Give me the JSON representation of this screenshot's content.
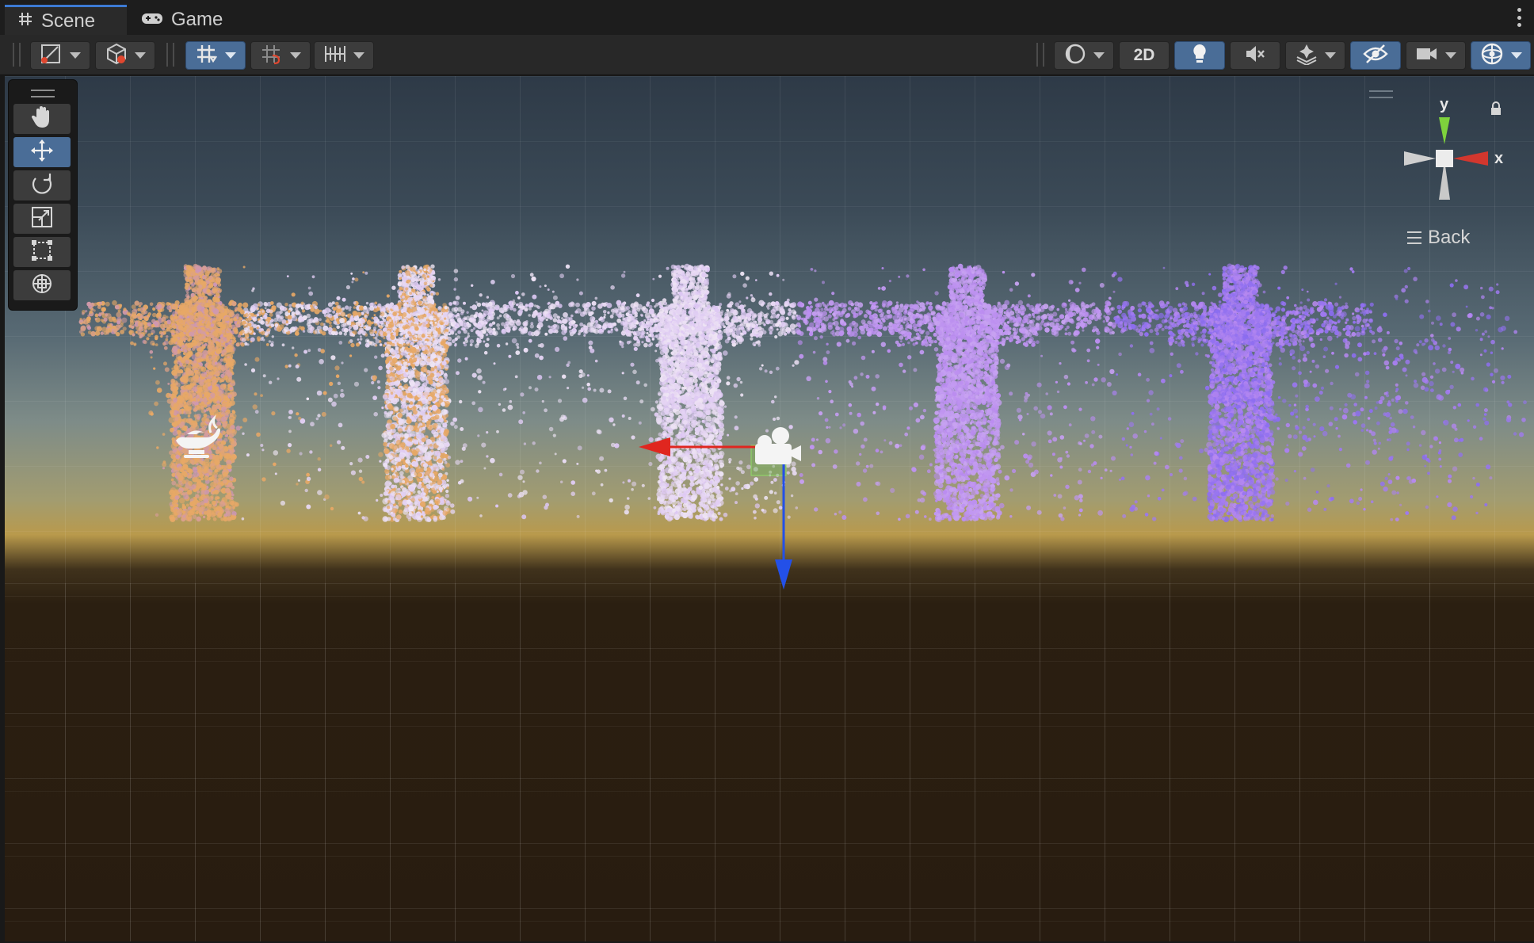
{
  "tabs": [
    {
      "label": "Scene",
      "icon": "hash-icon",
      "active": true
    },
    {
      "label": "Game",
      "icon": "gamepad-icon",
      "active": false
    }
  ],
  "toolbar": {
    "draw_mode_icon": "draw-mode-icon",
    "render_mode_icon": "render-mode-icon",
    "grid_snapping_icon": "grid-snapping-icon",
    "increment_snap_icon": "increment-snap-icon",
    "grid_visibility_icon": "grid-visibility-icon",
    "shading_icon": "shading-icon",
    "toggle_2d_label": "2D",
    "lighting_icon": "lightbulb-icon",
    "audio_icon": "audio-mute-icon",
    "effects_icon": "effects-icon",
    "hidden_objects_icon": "eye-slash-icon",
    "camera_icon": "camera-icon",
    "gizmos_icon": "gizmos-icon",
    "active": {
      "toggle_2d": false,
      "lighting": true,
      "hidden_objects": true,
      "gizmos": true,
      "grid_snapping": true
    }
  },
  "tools": [
    {
      "name": "hand-tool",
      "icon": "hand-icon",
      "active": false
    },
    {
      "name": "move-tool",
      "icon": "move-icon",
      "active": true
    },
    {
      "name": "rotate-tool",
      "icon": "rotate-icon",
      "active": false
    },
    {
      "name": "scale-tool",
      "icon": "scale-icon",
      "active": false
    },
    {
      "name": "rect-tool",
      "icon": "rect-icon",
      "active": false
    },
    {
      "name": "transform-tool",
      "icon": "transform-icon",
      "active": false
    }
  ],
  "orientation_gizmo": {
    "y_label": "y",
    "x_label": "x",
    "view_label": "Back",
    "colors": {
      "x": "#d2372e",
      "y": "#7ed23c",
      "neutral": "#cfcfcf"
    }
  },
  "scene": {
    "colors": {
      "sky_top": "#2e3a47",
      "horizon": "#b99a4c",
      "ground": "#281c10",
      "particle_orange": "#e7a866",
      "particle_white": "#efe6f4",
      "particle_purple": "#b98af0",
      "particle_violet": "#8a6cf0",
      "handle_x": "#e0261f",
      "handle_z": "#2350e8",
      "handle_y_plane": "#6fc04a"
    },
    "objects": [
      "light-icon",
      "camera-gizmo",
      "transform-handle"
    ]
  }
}
